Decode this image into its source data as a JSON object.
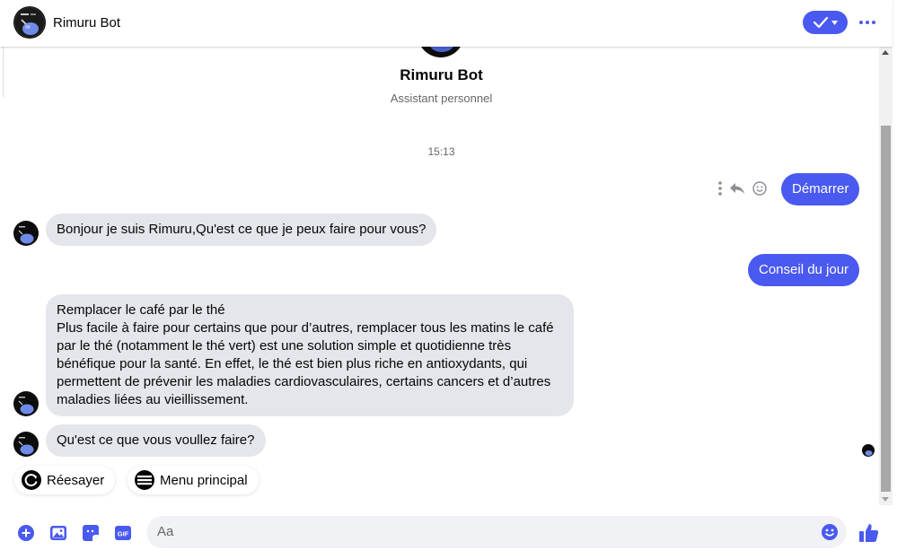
{
  "header": {
    "bot_name": "Rimuru Bot"
  },
  "profile": {
    "name": "Rimuru Bot",
    "subtitle": "Assistant personnel"
  },
  "timestamp": "15:13",
  "messages": [
    {
      "sender": "user",
      "text": "Démarrer"
    },
    {
      "sender": "bot",
      "text": "Bonjour je suis Rimuru,Qu'est ce que je peux faire pour vous?"
    },
    {
      "sender": "user",
      "text": "Conseil du jour"
    },
    {
      "sender": "bot",
      "lines": [
        "Remplacer le café par le thé",
        "Plus facile à faire pour certains que pour d’autres, remplacer tous les matins le café",
        "par le thé (notamment le thé vert) est une solution simple et quotidienne très",
        "bénéfique pour la santé. En effet, le thé est bien plus riche en antioxydants, qui",
        "permettent de prévenir les maladies cardiovasculaires, certains cancers et d’autres",
        "maladies liées au vieillissement."
      ]
    },
    {
      "sender": "bot",
      "text": "Qu'est ce que vous voullez faire?"
    }
  ],
  "quick_replies": [
    {
      "label": "Réesayer",
      "icon": "refresh-icon"
    },
    {
      "label": "Menu principal",
      "icon": "menu-icon"
    }
  ],
  "composer": {
    "placeholder": "Aa",
    "icons": [
      "plus-icon",
      "image-icon",
      "sticker-icon",
      "gif-icon",
      "emoji-icon",
      "thumbs-up-icon"
    ]
  },
  "colors": {
    "accent": "#4a59f0",
    "bot_bubble": "#e4e6eb",
    "muted_text": "#65676b"
  }
}
